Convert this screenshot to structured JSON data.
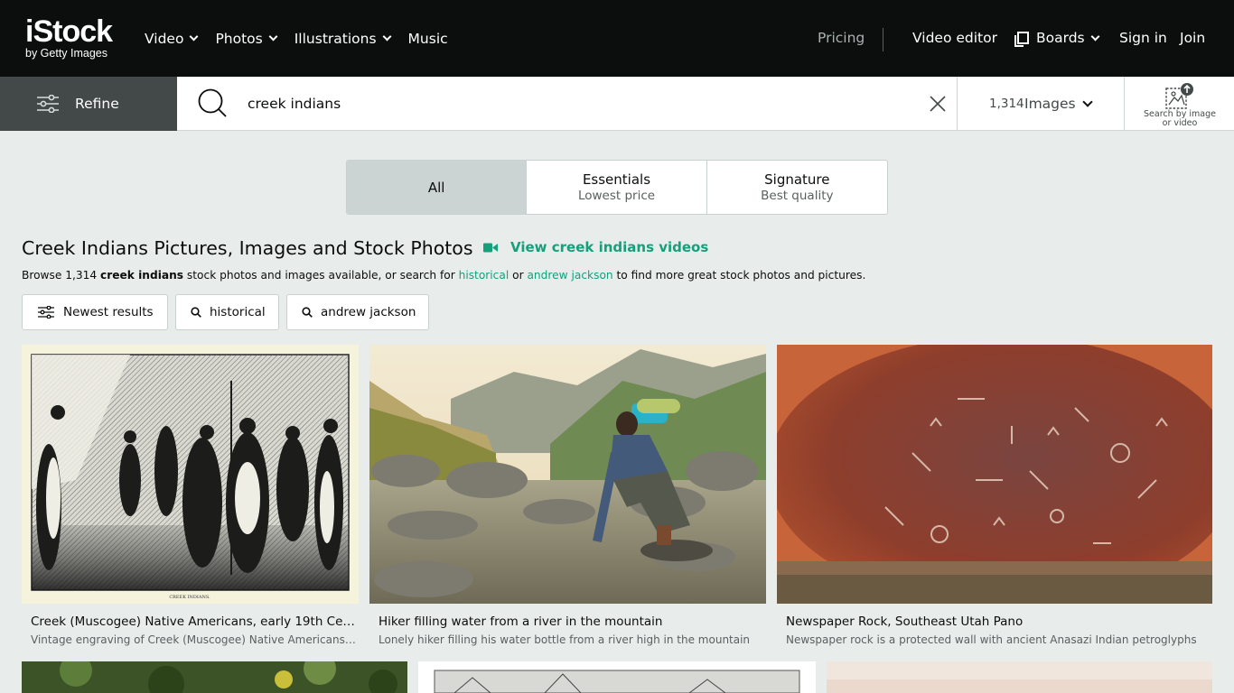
{
  "brand": {
    "logo_main": "iStock",
    "logo_sub": "by Getty Images"
  },
  "nav": {
    "left": [
      {
        "label": "Video",
        "has_dropdown": true
      },
      {
        "label": "Photos",
        "has_dropdown": true
      },
      {
        "label": "Illustrations",
        "has_dropdown": true
      },
      {
        "label": "Music",
        "has_dropdown": false
      }
    ],
    "pricing": "Pricing",
    "video_editor": "Video editor",
    "boards": "Boards",
    "sign_in": "Sign in",
    "join": "Join"
  },
  "search": {
    "refine_label": "Refine",
    "query": "creek indians",
    "result_count": "1,314",
    "media_type": "Images",
    "image_search_label": "Search by image or video"
  },
  "segments": [
    {
      "title": "All",
      "subtitle": "",
      "active": true
    },
    {
      "title": "Essentials",
      "subtitle": "Lowest price",
      "active": false
    },
    {
      "title": "Signature",
      "subtitle": "Best quality",
      "active": false
    }
  ],
  "heading": {
    "title": "Creek Indians Pictures, Images and Stock Photos",
    "videos_link": "View creek indians videos"
  },
  "browse": {
    "prefix": "Browse 1,314 ",
    "term": "creek indians",
    "middle": " stock photos and images available, or search for ",
    "link1": "historical",
    "or": " or ",
    "link2": "andrew jackson",
    "suffix": " to find more great stock photos and pictures."
  },
  "chips": [
    {
      "label": "Newest results",
      "icon": "sliders-icon"
    },
    {
      "label": "historical",
      "icon": "search-icon"
    },
    {
      "label": "andrew jackson",
      "icon": "search-icon"
    }
  ],
  "results": [
    {
      "title": "Creek (Muscogee) Native Americans, early 19th Cen...",
      "subtitle": "Vintage engraving of Creek (Muscogee) Native Americans, e...",
      "engraving_caption": "CREEK INDIANS."
    },
    {
      "title": "Hiker filling water from a river in the mountain",
      "subtitle": "Lonely hiker filling his water bottle from a river high in the mountain"
    },
    {
      "title": "Newspaper Rock, Southeast Utah Pano",
      "subtitle": "Newspaper rock is a protected wall with ancient Anasazi Indian petroglyphs"
    }
  ],
  "colors": {
    "nav_bg": "#0c0d0d",
    "accent_green": "#15a07c",
    "page_bg": "#e8edec",
    "refine_bg": "#434949"
  }
}
